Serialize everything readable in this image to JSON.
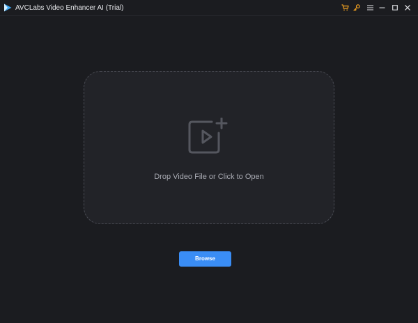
{
  "window": {
    "title": "AVCLabs Video Enhancer AI (Trial)"
  },
  "titlebar": {
    "buttons": [
      {
        "name": "cart-icon",
        "color": "#f0a020"
      },
      {
        "name": "key-icon",
        "color": "#f0a020"
      },
      {
        "name": "menu-icon",
        "color": "#d8d9dd"
      },
      {
        "name": "minimize-icon",
        "color": "#d8d9dd"
      },
      {
        "name": "maximize-icon",
        "color": "#d8d9dd"
      },
      {
        "name": "close-icon",
        "color": "#d8d9dd"
      }
    ]
  },
  "dropzone": {
    "icon": "add-video-icon",
    "text": "Drop Video File or Click to Open"
  },
  "browse": {
    "label": "Browse"
  },
  "colors": {
    "background": "#1b1c20",
    "dropzone_background": "#222328",
    "accent": "#3a8df5",
    "warning_icon": "#f0a020",
    "text_primary": "#e8e9ec",
    "text_secondary": "#a9abb3"
  }
}
